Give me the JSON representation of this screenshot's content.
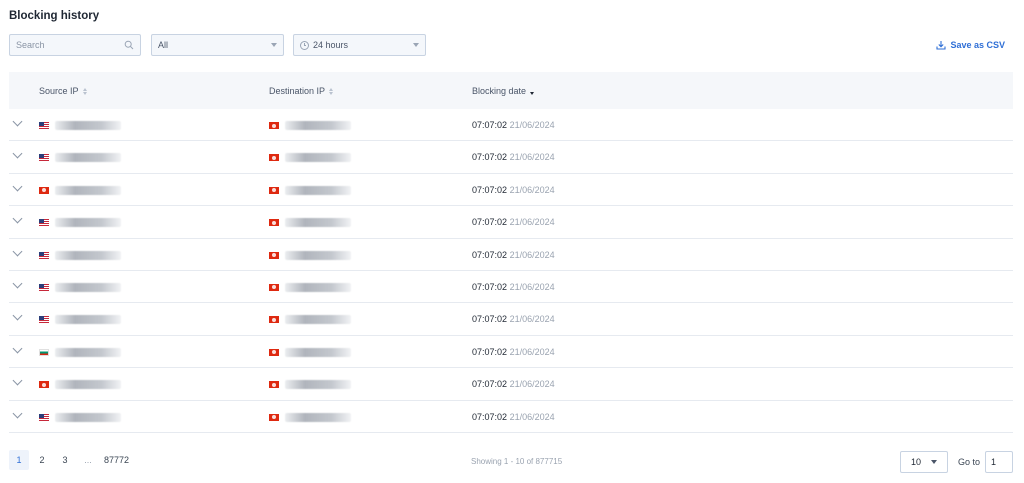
{
  "page": {
    "title": "Blocking history"
  },
  "filters": {
    "search_placeholder": "Search",
    "type_value": "All",
    "period_value": "24 hours"
  },
  "actions": {
    "save_csv_label": "Save as CSV"
  },
  "icons": {
    "search": "search-icon",
    "clock": "clock-icon",
    "download": "download-icon",
    "expand": "chevron-down-icon"
  },
  "colors": {
    "accent": "#2f6fd6",
    "header_bg": "#f5f7fa",
    "muted_text": "#9aa3b0"
  },
  "table": {
    "columns": {
      "source_ip": "Source IP",
      "destination_ip": "Destination IP",
      "blocking_date": "Blocking date"
    },
    "rows": [
      {
        "source_flag": "us",
        "dest_flag": "hk",
        "time": "07:07:02",
        "date": "21/06/2024"
      },
      {
        "source_flag": "us",
        "dest_flag": "hk",
        "time": "07:07:02",
        "date": "21/06/2024"
      },
      {
        "source_flag": "hk",
        "dest_flag": "hk",
        "time": "07:07:02",
        "date": "21/06/2024"
      },
      {
        "source_flag": "us",
        "dest_flag": "hk",
        "time": "07:07:02",
        "date": "21/06/2024"
      },
      {
        "source_flag": "us",
        "dest_flag": "hk",
        "time": "07:07:02",
        "date": "21/06/2024"
      },
      {
        "source_flag": "us",
        "dest_flag": "hk",
        "time": "07:07:02",
        "date": "21/06/2024"
      },
      {
        "source_flag": "us",
        "dest_flag": "hk",
        "time": "07:07:02",
        "date": "21/06/2024"
      },
      {
        "source_flag": "bg",
        "dest_flag": "hk",
        "time": "07:07:02",
        "date": "21/06/2024"
      },
      {
        "source_flag": "hk",
        "dest_flag": "hk",
        "time": "07:07:02",
        "date": "21/06/2024"
      },
      {
        "source_flag": "us",
        "dest_flag": "hk",
        "time": "07:07:02",
        "date": "21/06/2024"
      }
    ]
  },
  "pagination": {
    "pages": [
      "1",
      "2",
      "3"
    ],
    "ellipsis": "...",
    "last_page": "87772",
    "current_page": "1",
    "showing_text": "Showing 1 - 10 of 877715",
    "per_page": "10",
    "goto_label": "Go to",
    "goto_value": "1"
  }
}
